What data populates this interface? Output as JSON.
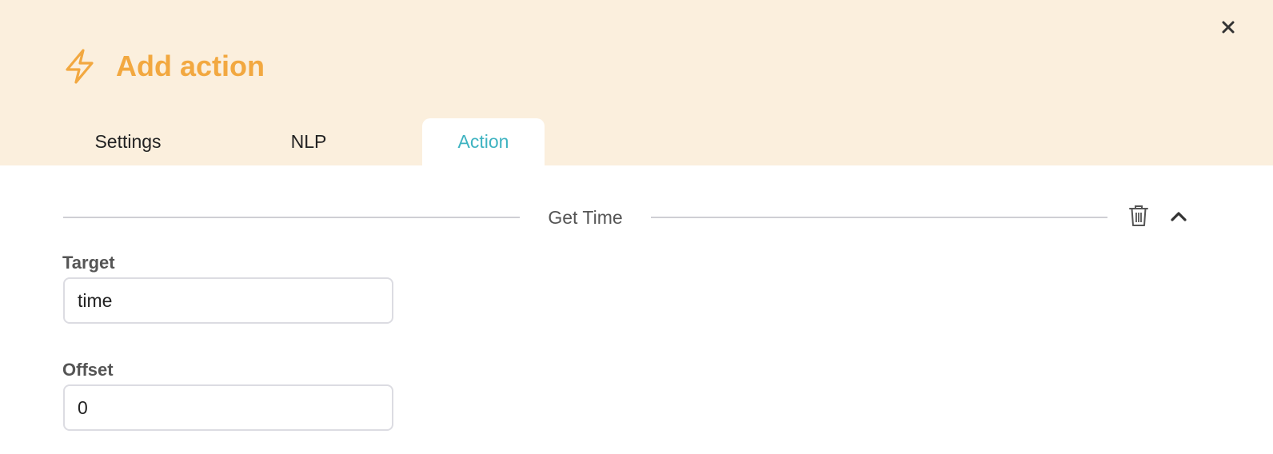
{
  "dialog": {
    "title": "Add action",
    "title_icon": "lightning-bolt-icon",
    "close_icon": "close-icon",
    "accent_color": "#f2a840",
    "header_bg": "#fbefdd"
  },
  "tabs": [
    {
      "label": "Settings",
      "active": false
    },
    {
      "label": "NLP",
      "active": false
    },
    {
      "label": "Action",
      "active": true,
      "color": "#3eb3c1"
    }
  ],
  "action_section": {
    "title": "Get Time",
    "delete_icon": "trash-icon",
    "collapse_icon": "chevron-up-icon",
    "fields": [
      {
        "label": "Target",
        "value": "time"
      },
      {
        "label": "Offset",
        "value": "0"
      }
    ]
  }
}
